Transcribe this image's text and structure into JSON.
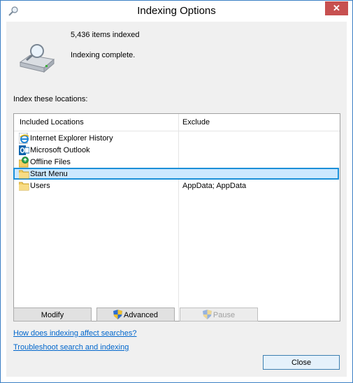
{
  "window": {
    "title": "Indexing Options",
    "close_glyph": "✕"
  },
  "status": {
    "items_indexed": "5,436 items indexed",
    "message": "Indexing complete."
  },
  "locations_label": "Index these locations:",
  "list": {
    "headers": {
      "included": "Included Locations",
      "exclude": "Exclude"
    },
    "rows": [
      {
        "name": "Internet Explorer History",
        "exclude": "",
        "icon": "ie-icon"
      },
      {
        "name": "Microsoft Outlook",
        "exclude": "",
        "icon": "outlook-icon"
      },
      {
        "name": "Offline Files",
        "exclude": "",
        "icon": "offline-files-icon"
      },
      {
        "name": "Start Menu",
        "exclude": "",
        "icon": "folder-icon",
        "selected": true
      },
      {
        "name": "Users",
        "exclude": "AppData; AppData",
        "icon": "folder-icon"
      }
    ]
  },
  "buttons": {
    "modify": "Modify",
    "advanced": "Advanced",
    "pause": "Pause",
    "close": "Close"
  },
  "links": {
    "how": "How does indexing affect searches?",
    "troubleshoot": "Troubleshoot search and indexing"
  },
  "colors": {
    "selection": "#cce8ff",
    "selection_border": "#1b8fd8",
    "link": "#0066cc",
    "close_button": "#c75050"
  }
}
